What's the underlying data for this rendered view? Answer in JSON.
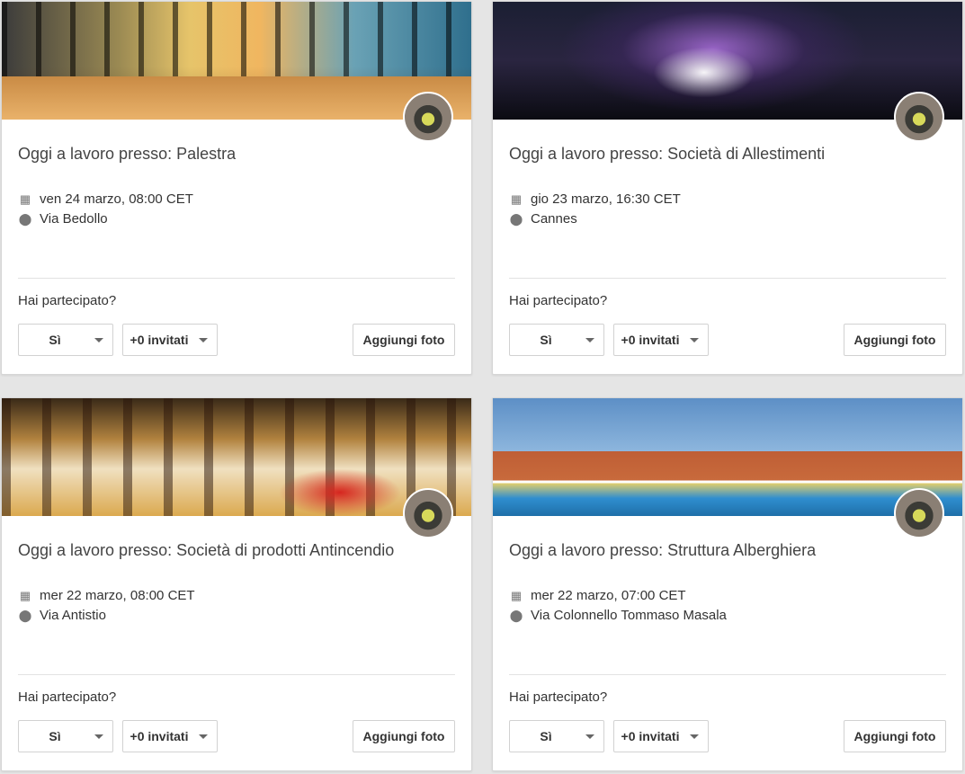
{
  "cards": [
    {
      "title": "Oggi a lavoro presso: Palestra",
      "date": "ven 24 marzo, 08:00 CET",
      "location": "Via Bedollo",
      "question": "Hai partecipato?",
      "rsvp": "Sì",
      "guests": "+0 invitati",
      "add_photo": "Aggiungi foto"
    },
    {
      "title": "Oggi a lavoro presso: Società di Allestimenti",
      "date": "gio 23 marzo, 16:30 CET",
      "location": "Cannes",
      "question": "Hai partecipato?",
      "rsvp": "Sì",
      "guests": "+0 invitati",
      "add_photo": "Aggiungi foto"
    },
    {
      "title": "Oggi a lavoro presso: Società di prodotti Antincendio",
      "date": "mer 22 marzo, 08:00 CET",
      "location": "Via Antistio",
      "question": "Hai partecipato?",
      "rsvp": "Sì",
      "guests": "+0 invitati",
      "add_photo": "Aggiungi foto"
    },
    {
      "title": "Oggi a lavoro presso: Struttura Alberghiera",
      "date": "mer 22 marzo, 07:00 CET",
      "location": "Via Colonnello Tommaso Masala",
      "question": "Hai partecipato?",
      "rsvp": "Sì",
      "guests": "+0 invitati",
      "add_photo": "Aggiungi foto"
    }
  ]
}
